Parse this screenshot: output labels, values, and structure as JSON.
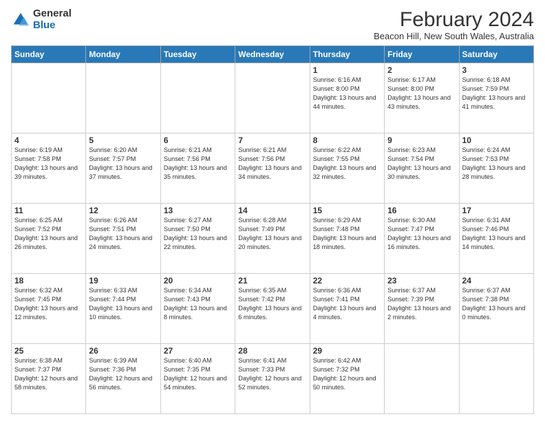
{
  "logo": {
    "general": "General",
    "blue": "Blue"
  },
  "title": "February 2024",
  "subtitle": "Beacon Hill, New South Wales, Australia",
  "days_header": [
    "Sunday",
    "Monday",
    "Tuesday",
    "Wednesday",
    "Thursday",
    "Friday",
    "Saturday"
  ],
  "weeks": [
    [
      {
        "day": "",
        "info": ""
      },
      {
        "day": "",
        "info": ""
      },
      {
        "day": "",
        "info": ""
      },
      {
        "day": "",
        "info": ""
      },
      {
        "day": "1",
        "info": "Sunrise: 6:16 AM\nSunset: 8:00 PM\nDaylight: 13 hours and 44 minutes."
      },
      {
        "day": "2",
        "info": "Sunrise: 6:17 AM\nSunset: 8:00 PM\nDaylight: 13 hours and 43 minutes."
      },
      {
        "day": "3",
        "info": "Sunrise: 6:18 AM\nSunset: 7:59 PM\nDaylight: 13 hours and 41 minutes."
      }
    ],
    [
      {
        "day": "4",
        "info": "Sunrise: 6:19 AM\nSunset: 7:58 PM\nDaylight: 13 hours and 39 minutes."
      },
      {
        "day": "5",
        "info": "Sunrise: 6:20 AM\nSunset: 7:57 PM\nDaylight: 13 hours and 37 minutes."
      },
      {
        "day": "6",
        "info": "Sunrise: 6:21 AM\nSunset: 7:56 PM\nDaylight: 13 hours and 35 minutes."
      },
      {
        "day": "7",
        "info": "Sunrise: 6:21 AM\nSunset: 7:56 PM\nDaylight: 13 hours and 34 minutes."
      },
      {
        "day": "8",
        "info": "Sunrise: 6:22 AM\nSunset: 7:55 PM\nDaylight: 13 hours and 32 minutes."
      },
      {
        "day": "9",
        "info": "Sunrise: 6:23 AM\nSunset: 7:54 PM\nDaylight: 13 hours and 30 minutes."
      },
      {
        "day": "10",
        "info": "Sunrise: 6:24 AM\nSunset: 7:53 PM\nDaylight: 13 hours and 28 minutes."
      }
    ],
    [
      {
        "day": "11",
        "info": "Sunrise: 6:25 AM\nSunset: 7:52 PM\nDaylight: 13 hours and 26 minutes."
      },
      {
        "day": "12",
        "info": "Sunrise: 6:26 AM\nSunset: 7:51 PM\nDaylight: 13 hours and 24 minutes."
      },
      {
        "day": "13",
        "info": "Sunrise: 6:27 AM\nSunset: 7:50 PM\nDaylight: 13 hours and 22 minutes."
      },
      {
        "day": "14",
        "info": "Sunrise: 6:28 AM\nSunset: 7:49 PM\nDaylight: 13 hours and 20 minutes."
      },
      {
        "day": "15",
        "info": "Sunrise: 6:29 AM\nSunset: 7:48 PM\nDaylight: 13 hours and 18 minutes."
      },
      {
        "day": "16",
        "info": "Sunrise: 6:30 AM\nSunset: 7:47 PM\nDaylight: 13 hours and 16 minutes."
      },
      {
        "day": "17",
        "info": "Sunrise: 6:31 AM\nSunset: 7:46 PM\nDaylight: 13 hours and 14 minutes."
      }
    ],
    [
      {
        "day": "18",
        "info": "Sunrise: 6:32 AM\nSunset: 7:45 PM\nDaylight: 13 hours and 12 minutes."
      },
      {
        "day": "19",
        "info": "Sunrise: 6:33 AM\nSunset: 7:44 PM\nDaylight: 13 hours and 10 minutes."
      },
      {
        "day": "20",
        "info": "Sunrise: 6:34 AM\nSunset: 7:43 PM\nDaylight: 13 hours and 8 minutes."
      },
      {
        "day": "21",
        "info": "Sunrise: 6:35 AM\nSunset: 7:42 PM\nDaylight: 13 hours and 6 minutes."
      },
      {
        "day": "22",
        "info": "Sunrise: 6:36 AM\nSunset: 7:41 PM\nDaylight: 13 hours and 4 minutes."
      },
      {
        "day": "23",
        "info": "Sunrise: 6:37 AM\nSunset: 7:39 PM\nDaylight: 13 hours and 2 minutes."
      },
      {
        "day": "24",
        "info": "Sunrise: 6:37 AM\nSunset: 7:38 PM\nDaylight: 13 hours and 0 minutes."
      }
    ],
    [
      {
        "day": "25",
        "info": "Sunrise: 6:38 AM\nSunset: 7:37 PM\nDaylight: 12 hours and 58 minutes."
      },
      {
        "day": "26",
        "info": "Sunrise: 6:39 AM\nSunset: 7:36 PM\nDaylight: 12 hours and 56 minutes."
      },
      {
        "day": "27",
        "info": "Sunrise: 6:40 AM\nSunset: 7:35 PM\nDaylight: 12 hours and 54 minutes."
      },
      {
        "day": "28",
        "info": "Sunrise: 6:41 AM\nSunset: 7:33 PM\nDaylight: 12 hours and 52 minutes."
      },
      {
        "day": "29",
        "info": "Sunrise: 6:42 AM\nSunset: 7:32 PM\nDaylight: 12 hours and 50 minutes."
      },
      {
        "day": "",
        "info": ""
      },
      {
        "day": "",
        "info": ""
      }
    ]
  ]
}
